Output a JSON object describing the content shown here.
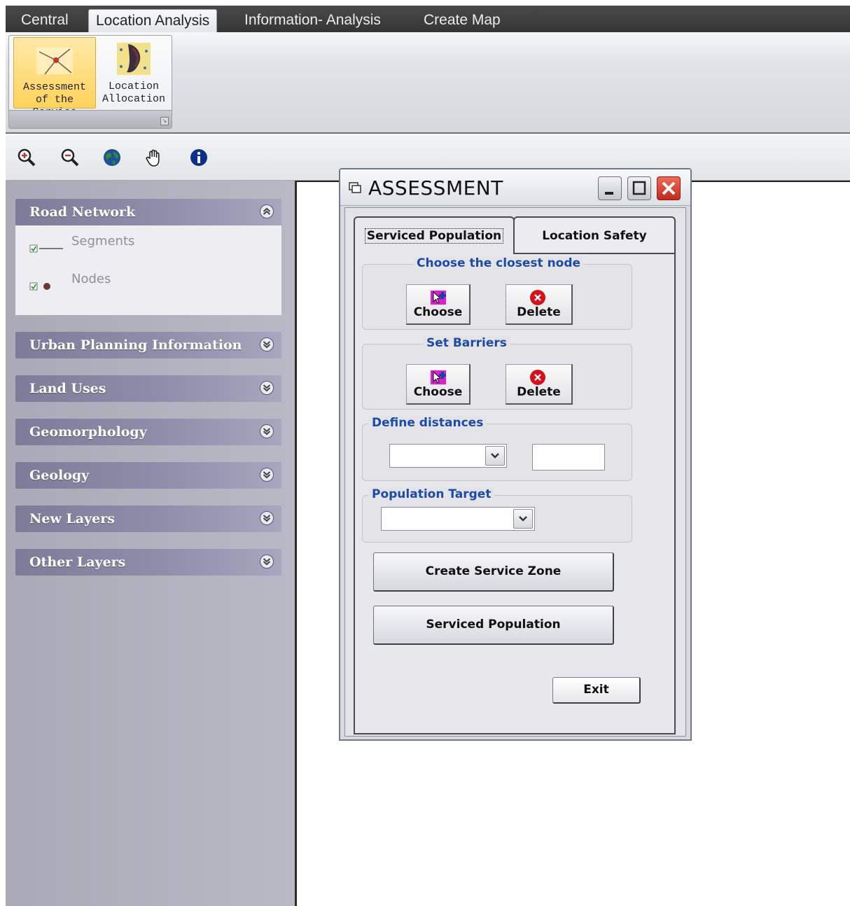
{
  "ribbon": {
    "tabs": [
      {
        "label": "Central"
      },
      {
        "label": "Location Analysis"
      },
      {
        "label": "Information- Analysis"
      },
      {
        "label": "Create Map"
      }
    ],
    "buttons": [
      {
        "label": "Assessment\nof the Service",
        "icon": "network-node-icon"
      },
      {
        "label": "Location\nAllocation",
        "icon": "allocation-map-icon"
      }
    ]
  },
  "toolbar": {
    "tools": [
      "zoom-in-icon",
      "zoom-out-icon",
      "globe-icon",
      "pan-hand-icon",
      "info-icon"
    ]
  },
  "layers": {
    "groups": [
      {
        "title": "Road Network",
        "expanded": true
      },
      {
        "title": "Urban Planning Information"
      },
      {
        "title": "Land Uses"
      },
      {
        "title": "Geomorphology"
      },
      {
        "title": "Geology"
      },
      {
        "title": "New Layers"
      },
      {
        "title": "Other Layers"
      }
    ],
    "road_items": [
      {
        "label": "Segments"
      },
      {
        "label": "Nodes"
      }
    ]
  },
  "dialog": {
    "title": "ASSESSMENT",
    "tabs": [
      {
        "label": "Serviced Population"
      },
      {
        "label": "Location Safety"
      }
    ],
    "closest_node": {
      "legend": "Choose the closest node",
      "choose": "Choose",
      "delete": "Delete"
    },
    "barriers": {
      "legend": "Set Barriers",
      "choose": "Choose",
      "delete": "Delete"
    },
    "distances": {
      "legend": "Define distances",
      "selected": "",
      "value": ""
    },
    "population": {
      "legend": "Population Target",
      "selected": ""
    },
    "create_zone": "Create Service Zone",
    "serviced_population": "Serviced Population",
    "exit": "Exit"
  },
  "colors": {
    "ribbon_dark": "#3c3c3c",
    "active_ribbon_button": "#ffd25a",
    "layer_header": "#8a8aa6",
    "legend_blue": "#1c4aa8",
    "close_red": "#d63a2a"
  }
}
